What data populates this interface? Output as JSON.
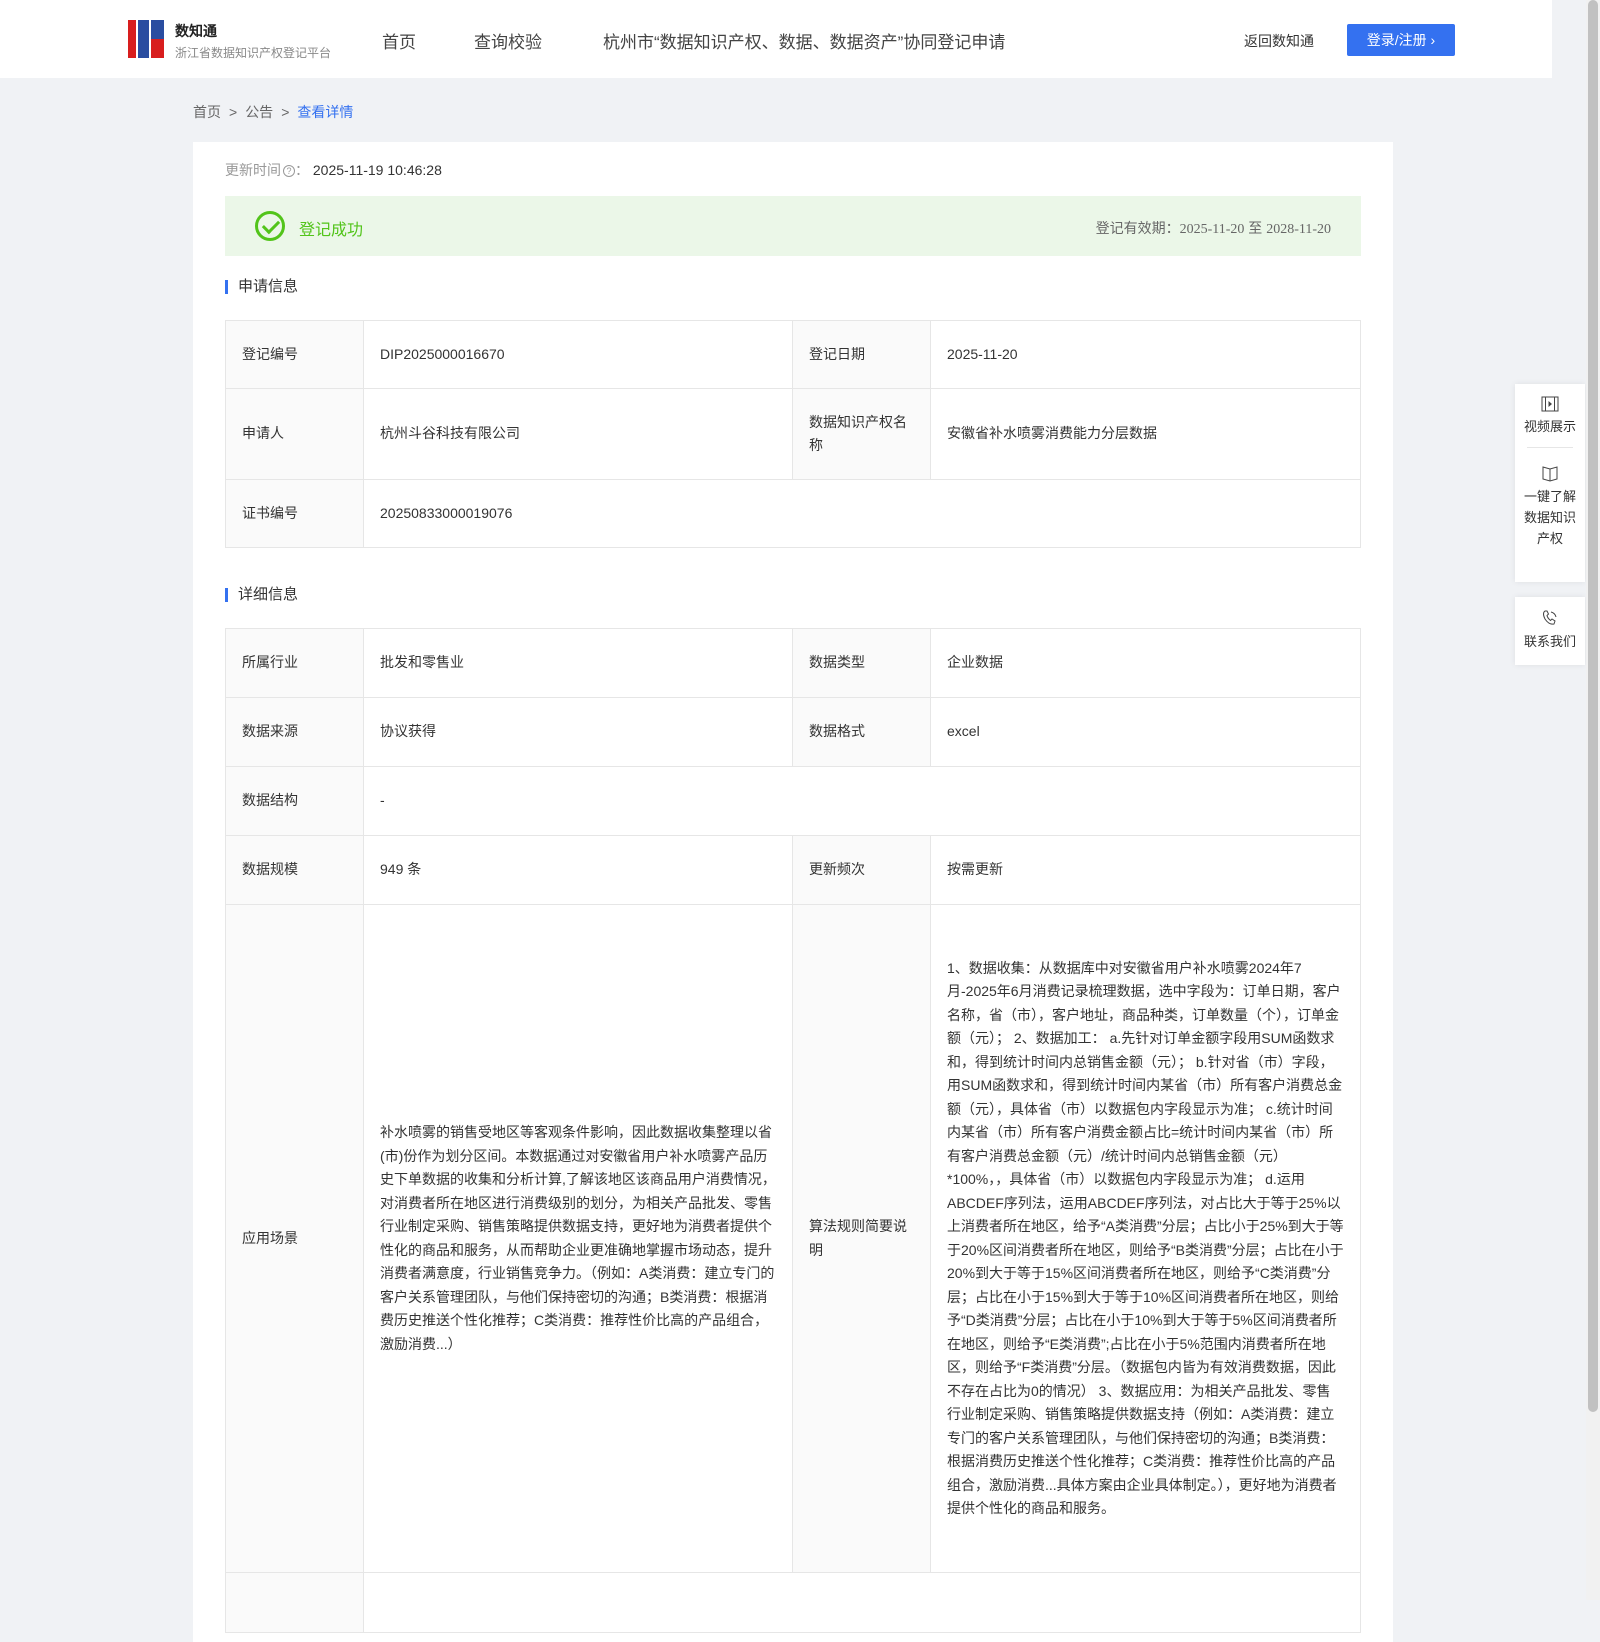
{
  "header": {
    "brand_title": "数知通",
    "brand_subtitle": "浙江省数据知识产权登记平台",
    "nav": [
      "首页",
      "查询校验",
      "杭州市“数据知识产权、数据、数据资产”协同登记申请"
    ],
    "back": "返回数知通",
    "login": "登录/注册 ›"
  },
  "breadcrumb": [
    "首页",
    "公告",
    "查看详情"
  ],
  "update": {
    "label": "更新时间",
    "value": "2025-11-19 10:46:28"
  },
  "status": {
    "text": "登记成功",
    "valid_label": "登记有效期：",
    "valid_from": "2025-11-20",
    "valid_to_word": "至",
    "valid_to": "2028-11-20",
    "color": "#52c41a"
  },
  "section1": {
    "title": "申请信息",
    "rows": [
      [
        "登记编号",
        "DIP2025000016670",
        "登记日期",
        "2025-11-20"
      ],
      [
        "申请人",
        "杭州斗谷科技有限公司",
        "数据知识产权名称",
        "安徽省补水喷雾消费能力分层数据"
      ],
      [
        "证书编号",
        "20250833000019076"
      ]
    ]
  },
  "section2": {
    "title": "详细信息",
    "rows": [
      [
        "所属行业",
        "批发和零售业",
        "数据类型",
        "企业数据"
      ],
      [
        "数据来源",
        "协议获得",
        "数据格式",
        "excel"
      ],
      [
        "数据结构",
        "-"
      ],
      [
        "数据规模",
        "949 条",
        "更新频次",
        "按需更新"
      ],
      [
        "应用场景",
        "补水喷雾的销售受地区等客观条件影响，因此数据收集整理以省(市)份作为划分区间。本数据通过对安徽省用户补水喷雾产品历史下单数据的收集和分析计算,了解该地区该商品用户消费情况，对消费者所在地区进行消费级别的划分，为相关产品批发、零售行业制定采购、销售策略提供数据支持，更好地为消费者提供个性化的商品和服务，从而帮助企业更准确地掌握市场动态，提升消费者满意度，行业销售竞争力。（例如：A类消费：建立专门的客户关系管理团队，与他们保持密切的沟通；B类消费：根据消费历史推送个性化推荐；C类消费：推荐性价比高的产品组合，激励消费...）",
        "算法规则简要说明",
        "1、数据收集：从数据库中对安徽省用户补水喷雾2024年7月-2025年6月消费记录梳理数据，选中字段为：订单日期，客户名称，省（市），客户地址，商品种类，订单数量（个），订单金额（元）； 2、数据加工： a.先针对订单金额字段用SUM函数求和，得到统计时间内总销售金额（元）； b.针对省（市）字段，用SUM函数求和，得到统计时间内某省（市）所有客户消费总金额（元），具体省（市）以数据包内字段显示为准； c.统计时间内某省（市）所有客户消费金额占比=统计时间内某省（市）所有客户消费总金额（元）/统计时间内总销售金额（元）*100%，，具体省（市）以数据包内字段显示为准； d.运用ABCDEF序列法，运用ABCDEF序列法，对占比大于等于25%以上消费者所在地区，给予“A类消费”分层；占比小于25%到大于等于20%区间消费者所在地区，则给予“B类消费”分层；占比在小于20%到大于等于15%区间消费者所在地区，则给予“C类消费”分层；占比在小于15%到大于等于10%区间消费者所在地区，则给予“D类消费”分层；占比在小于10%到大于等于5%区间消费者所在地区，则给予“E类消费”;占比在小于5%范围内消费者所在地区，则给予“F类消费”分层。（数据包内皆为有效消费数据，因此不存在占比为0的情况） 3、数据应用：为相关产品批发、零售行业制定采购、销售策略提供数据支持（例如：A类消费：建立专门的客户关系管理团队，与他们保持密切的沟通；B类消费：根据消费历史推送个性化推荐；C类消费：推荐性价比高的产品组合，激励消费...具体方案由企业具体制定。），更好地为消费者提供个性化的商品和服务。"
      ]
    ]
  },
  "float": {
    "video": "视频展示",
    "learn": "一键了解数据知识产权",
    "contact": "联系我们"
  }
}
